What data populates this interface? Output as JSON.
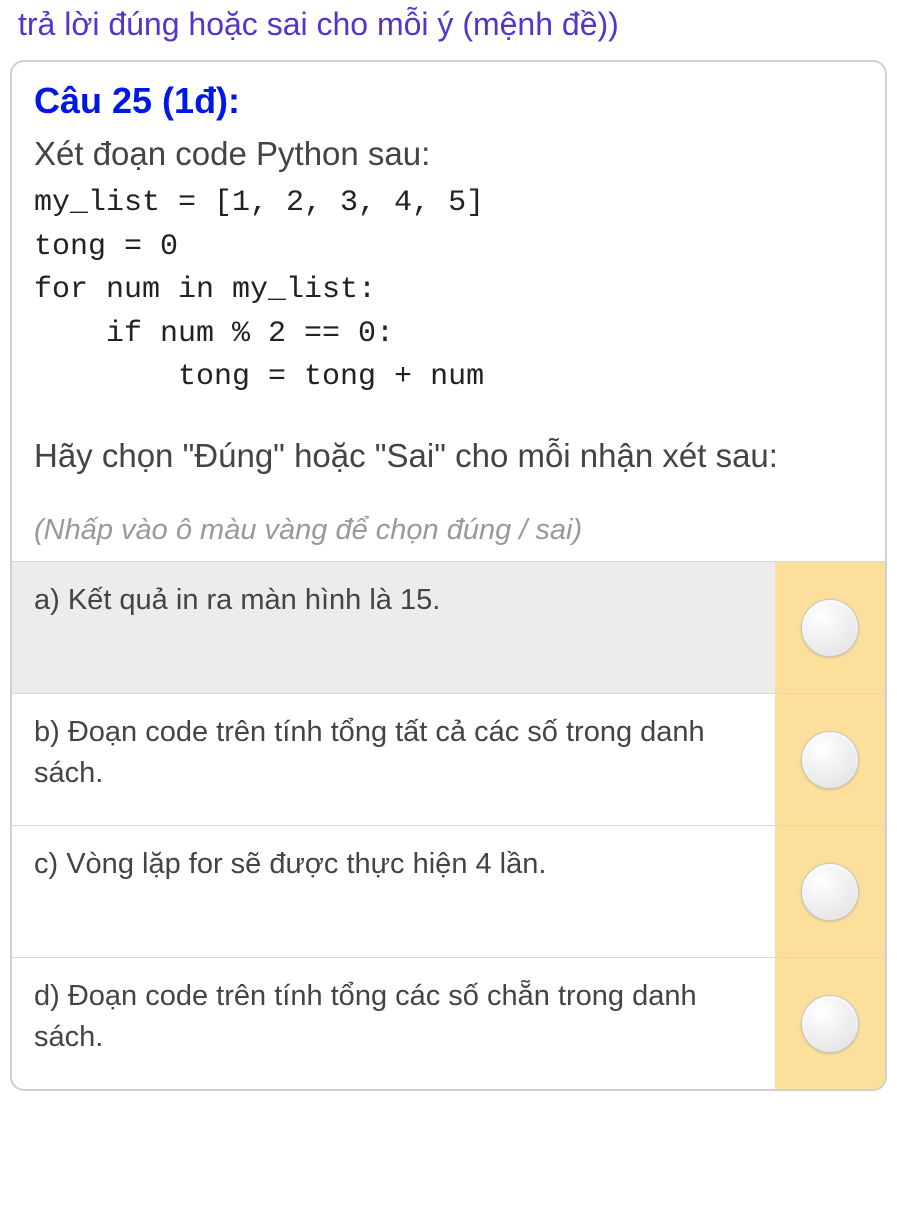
{
  "top_instruction": "trả lời đúng hoặc sai cho mỗi ý (mệnh đề))",
  "question": {
    "title": "Câu 25 (1đ):",
    "intro": "Xét đoạn code Python sau:",
    "code": "my_list = [1, 2, 3, 4, 5]\ntong = 0\nfor num in my_list:\n    if num % 2 == 0:\n        tong = tong + num",
    "prompt": "Hãy chọn \"Đúng\" hoặc \"Sai\" cho mỗi nhận xét sau:",
    "hint": "(Nhấp vào ô màu vàng để chọn đúng / sai)",
    "options": [
      {
        "label": "a) Kết quả in ra màn hình là 15."
      },
      {
        "label": "b) Đoạn code trên tính tổng tất cả các số trong danh sách."
      },
      {
        "label": "c) Vòng lặp for sẽ được thực hiện 4 lần."
      },
      {
        "label": "d) Đoạn code trên tính tổng các số chẵn trong danh sách."
      }
    ]
  }
}
